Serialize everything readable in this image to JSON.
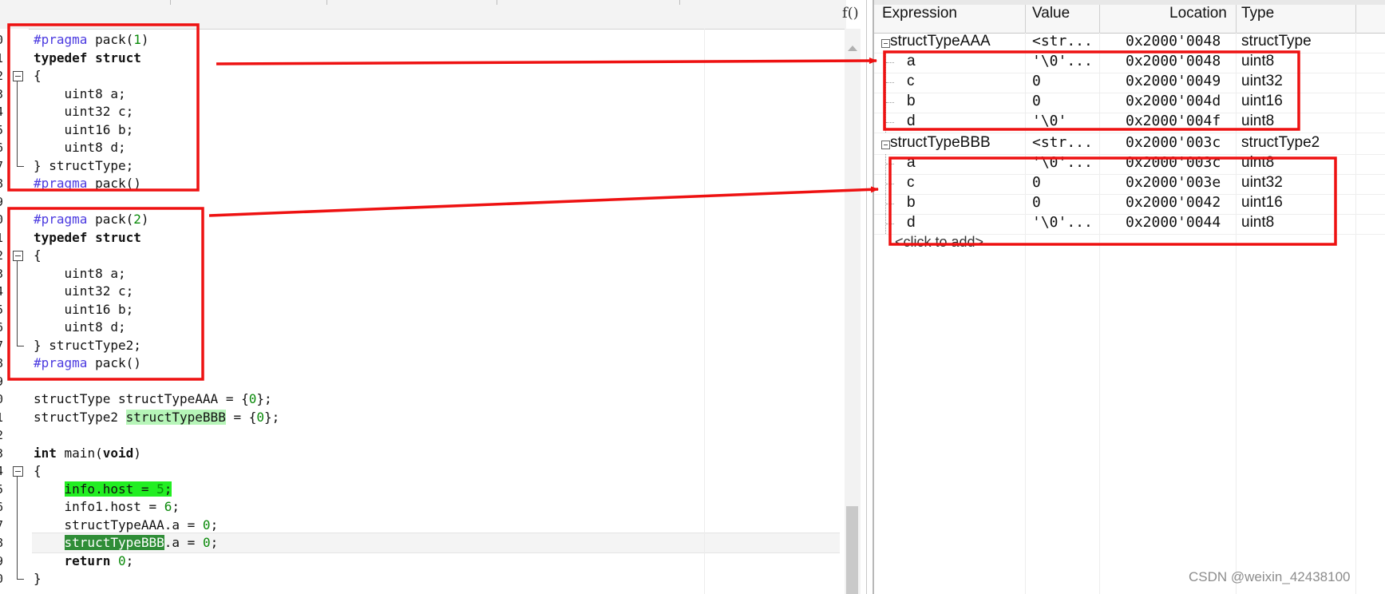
{
  "editor": {
    "function_button": "f()",
    "line_numbers": [
      "0",
      "1",
      "2",
      "3",
      "4",
      "5",
      "6",
      "7",
      "8",
      "9",
      "0",
      "1",
      "2",
      "3",
      "4",
      "5",
      "6",
      "7",
      "8",
      "9",
      "0",
      "1",
      "2",
      "3",
      "4",
      "5",
      "6",
      "7",
      "8",
      "9",
      "0"
    ],
    "code": [
      "#pragma pack(1)",
      "typedef struct",
      "{",
      "    uint8 a;",
      "    uint32 c;",
      "    uint16 b;",
      "    uint8 d;",
      "} structType;",
      "#pragma pack()",
      "",
      "#pragma pack(2)",
      "typedef struct",
      "{",
      "    uint8 a;",
      "    uint32 c;",
      "    uint16 b;",
      "    uint8 d;",
      "} structType2;",
      "#pragma pack()",
      "",
      "structType structTypeAAA = {0};",
      "structType2 structTypeBBB = {0};",
      "",
      "int main(void)",
      "{",
      "    info.host = 5;",
      "    info1.host = 6;",
      "    structTypeAAA.a = 0;",
      "    structTypeBBB.a = 0;",
      "    return 0;",
      "}"
    ]
  },
  "watch": {
    "columns": [
      "Expression",
      "Value",
      "Location",
      "Type"
    ],
    "rows": [
      {
        "name": "structTypeAAA",
        "value": "<str...",
        "location": "0x2000'0048",
        "type": "structType",
        "level": 0
      },
      {
        "name": "a",
        "value": "'\\0'...",
        "location": "0x2000'0048",
        "type": "uint8",
        "level": 1
      },
      {
        "name": "c",
        "value": "0",
        "location": "0x2000'0049",
        "type": "uint32",
        "level": 1
      },
      {
        "name": "b",
        "value": "0",
        "location": "0x2000'004d",
        "type": "uint16",
        "level": 1
      },
      {
        "name": "d",
        "value": "'\\0'",
        "location": "0x2000'004f",
        "type": "uint8",
        "level": 1
      },
      {
        "name": "structTypeBBB",
        "value": "<str...",
        "location": "0x2000'003c",
        "type": "structType2",
        "level": 0
      },
      {
        "name": "a",
        "value": "'\\0'...",
        "location": "0x2000'003c",
        "type": "uint8",
        "level": 1
      },
      {
        "name": "c",
        "value": "0",
        "location": "0x2000'003e",
        "type": "uint32",
        "level": 1
      },
      {
        "name": "b",
        "value": "0",
        "location": "0x2000'0042",
        "type": "uint16",
        "level": 1
      },
      {
        "name": "d",
        "value": "'\\0'...",
        "location": "0x2000'0044",
        "type": "uint8",
        "level": 1
      }
    ],
    "add_row": "<click to add>"
  },
  "annotation": {
    "color": "#ee1111"
  },
  "watermark": "CSDN @weixin_42438100"
}
